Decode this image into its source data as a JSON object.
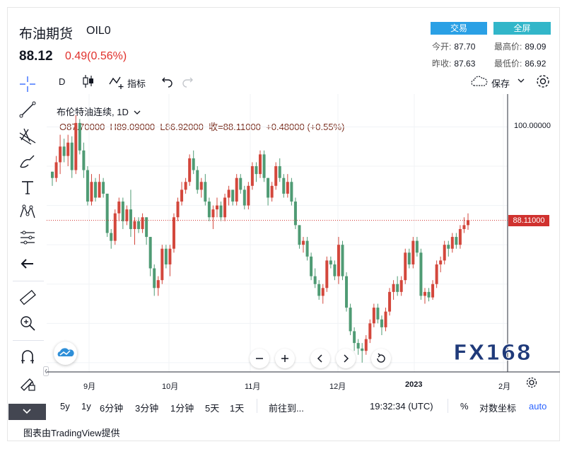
{
  "header": {
    "title": "布油期货",
    "symbol": "OIL0",
    "price": "88.12",
    "change": "0.49(0.56%)",
    "trade_button": "交易",
    "fullscreen_button": "全屏",
    "stats": [
      {
        "label": "今开:",
        "value": "87.70"
      },
      {
        "label": "最高价:",
        "value": "89.09"
      },
      {
        "label": "昨收:",
        "value": "87.63"
      },
      {
        "label": "最低价:",
        "value": "86.92"
      }
    ]
  },
  "toolbar": {
    "interval": "D",
    "indicators_label": "指标",
    "save_label": "保存"
  },
  "legend": {
    "series_name": "布伦特油连续, 1D",
    "ohlc": "O87.70000  H89.09000  L86.92000  收=88.11000  +0.48000 (+0.55%)"
  },
  "bottom_bar": {
    "ranges": [
      "5y",
      "1y",
      "6分钟",
      "3分钟",
      "1分钟",
      "5天",
      "1天"
    ],
    "goto_label": "前往到...",
    "time": "19:32:34 (UTC)",
    "percent": "%",
    "log_label": "对数坐标",
    "auto_label": "auto"
  },
  "footer": {
    "credit": "图表由TradingView提供"
  },
  "watermark": {
    "text": "FX168"
  },
  "colors": {
    "up": "#d3473c",
    "down": "#4f9b74",
    "price_line": "#d0322f",
    "accent": "#2962ff"
  },
  "chart_data": {
    "type": "candlestick",
    "x_ticks": [
      "9月",
      "10月",
      "11月",
      "12月",
      "2023",
      "2月"
    ],
    "y_ticks": [
      "100.00000"
    ],
    "last_price_label": "88.11000",
    "last_price": 88.11,
    "ylim": [
      69,
      104
    ],
    "candles": [
      [
        94.3,
        94.3,
        92.5,
        93.5
      ],
      [
        93.5,
        96.3,
        93.0,
        95.5
      ],
      [
        95.5,
        99.0,
        94.0,
        97.5
      ],
      [
        97.5,
        98.5,
        95.5,
        96.3
      ],
      [
        96.3,
        99.0,
        95.0,
        98.0
      ],
      [
        98.0,
        98.8,
        93.5,
        94.5
      ],
      [
        94.5,
        101.5,
        94.0,
        100.5
      ],
      [
        100.5,
        101.0,
        96.5,
        97.0
      ],
      [
        97.0,
        98.0,
        93.5,
        94.5
      ],
      [
        94.5,
        95.0,
        90.0,
        90.5
      ],
      [
        90.5,
        94.0,
        90.0,
        93.0
      ],
      [
        93.0,
        93.5,
        90.5,
        91.0
      ],
      [
        91.0,
        94.0,
        91.0,
        93.0
      ],
      [
        93.0,
        93.5,
        91.0,
        91.5
      ],
      [
        91.5,
        91.5,
        86.0,
        86.5
      ],
      [
        86.5,
        87.0,
        84.5,
        85.5
      ],
      [
        85.5,
        89.5,
        85.0,
        89.0
      ],
      [
        89.0,
        91.0,
        88.0,
        90.5
      ],
      [
        90.5,
        91.0,
        87.0,
        88.0
      ],
      [
        88.0,
        90.0,
        87.5,
        89.5
      ],
      [
        89.5,
        92.0,
        86.0,
        87.0
      ],
      [
        87.0,
        88.5,
        85.0,
        88.0
      ],
      [
        88.0,
        88.5,
        86.5,
        87.0
      ],
      [
        87.0,
        89.0,
        86.5,
        88.5
      ],
      [
        88.5,
        88.5,
        85.0,
        86.0
      ],
      [
        86.0,
        86.0,
        81.0,
        82.0
      ],
      [
        82.0,
        82.5,
        78.5,
        79.5
      ],
      [
        79.5,
        81.0,
        78.5,
        80.5
      ],
      [
        80.5,
        85.0,
        80.0,
        84.5
      ],
      [
        84.5,
        85.0,
        82.0,
        82.5
      ],
      [
        82.5,
        85.0,
        81.0,
        84.5
      ],
      [
        84.5,
        89.0,
        84.0,
        88.5
      ],
      [
        88.5,
        91.0,
        88.0,
        90.5
      ],
      [
        90.5,
        93.0,
        90.0,
        92.0
      ],
      [
        92.0,
        93.5,
        91.5,
        93.0
      ],
      [
        93.0,
        96.5,
        92.5,
        96.0
      ],
      [
        96.0,
        97.0,
        94.0,
        94.5
      ],
      [
        94.5,
        95.0,
        91.5,
        92.0
      ],
      [
        92.0,
        93.5,
        91.0,
        93.0
      ],
      [
        93.0,
        94.0,
        90.0,
        90.5
      ],
      [
        90.5,
        91.0,
        88.0,
        88.5
      ],
      [
        88.5,
        90.0,
        87.0,
        89.5
      ],
      [
        89.5,
        91.0,
        88.5,
        90.0
      ],
      [
        90.0,
        90.5,
        88.0,
        88.5
      ],
      [
        88.5,
        91.5,
        88.0,
        91.0
      ],
      [
        91.0,
        92.5,
        90.0,
        92.0
      ],
      [
        92.0,
        92.0,
        90.0,
        90.5
      ],
      [
        90.5,
        94.0,
        90.0,
        93.5
      ],
      [
        93.5,
        94.0,
        91.5,
        92.0
      ],
      [
        92.0,
        92.5,
        89.5,
        90.0
      ],
      [
        90.0,
        93.0,
        89.5,
        92.5
      ],
      [
        92.5,
        95.5,
        92.0,
        95.0
      ],
      [
        95.0,
        95.5,
        93.0,
        94.0
      ],
      [
        94.0,
        97.0,
        93.5,
        96.5
      ],
      [
        96.5,
        97.0,
        93.0,
        93.5
      ],
      [
        93.5,
        93.5,
        90.0,
        91.0
      ],
      [
        91.0,
        93.0,
        90.5,
        92.5
      ],
      [
        92.5,
        95.5,
        92.0,
        95.0
      ],
      [
        95.0,
        96.0,
        93.0,
        93.5
      ],
      [
        93.5,
        94.0,
        91.0,
        91.5
      ],
      [
        91.5,
        94.0,
        91.0,
        93.0
      ],
      [
        93.0,
        93.5,
        90.0,
        90.5
      ],
      [
        90.5,
        91.0,
        87.0,
        87.5
      ],
      [
        87.5,
        87.5,
        84.5,
        85.0
      ],
      [
        85.0,
        86.0,
        84.0,
        85.5
      ],
      [
        85.5,
        86.0,
        83.0,
        83.5
      ],
      [
        83.5,
        84.0,
        80.5,
        81.0
      ],
      [
        81.0,
        82.0,
        79.5,
        80.0
      ],
      [
        80.0,
        80.5,
        78.0,
        78.5
      ],
      [
        78.5,
        80.0,
        77.5,
        79.5
      ],
      [
        79.5,
        83.5,
        79.0,
        83.0
      ],
      [
        83.0,
        83.5,
        82.0,
        82.5
      ],
      [
        82.5,
        83.0,
        80.5,
        81.0
      ],
      [
        81.0,
        86.0,
        80.0,
        85.0
      ],
      [
        85.0,
        85.5,
        80.5,
        81.0
      ],
      [
        81.0,
        81.5,
        76.5,
        77.0
      ],
      [
        77.0,
        77.5,
        73.5,
        74.0
      ],
      [
        74.0,
        74.5,
        71.5,
        72.5
      ],
      [
        72.5,
        73.0,
        71.0,
        71.8
      ],
      [
        71.8,
        72.5,
        70.0,
        71.5
      ],
      [
        71.5,
        73.5,
        71.0,
        73.0
      ],
      [
        73.0,
        75.5,
        72.5,
        75.0
      ],
      [
        75.0,
        77.5,
        74.5,
        77.0
      ],
      [
        77.0,
        77.5,
        75.0,
        75.5
      ],
      [
        75.5,
        76.0,
        73.5,
        74.5
      ],
      [
        74.5,
        77.0,
        74.0,
        76.5
      ],
      [
        76.5,
        79.5,
        76.0,
        79.0
      ],
      [
        79.0,
        80.5,
        78.0,
        80.0
      ],
      [
        80.0,
        81.0,
        78.5,
        79.0
      ],
      [
        79.0,
        81.0,
        78.5,
        80.5
      ],
      [
        80.5,
        84.5,
        80.0,
        84.0
      ],
      [
        84.0,
        84.5,
        82.0,
        82.5
      ],
      [
        82.5,
        86.0,
        82.0,
        85.5
      ],
      [
        85.5,
        86.0,
        83.5,
        84.0
      ],
      [
        84.0,
        84.5,
        78.0,
        78.5
      ],
      [
        78.5,
        79.5,
        77.5,
        79.0
      ],
      [
        79.0,
        79.5,
        77.8,
        78.3
      ],
      [
        78.3,
        80.5,
        78.0,
        80.0
      ],
      [
        80.0,
        83.0,
        79.5,
        82.5
      ],
      [
        82.5,
        83.5,
        81.5,
        83.0
      ],
      [
        83.0,
        85.5,
        82.5,
        85.0
      ],
      [
        85.0,
        85.5,
        83.5,
        84.5
      ],
      [
        84.5,
        86.5,
        84.0,
        86.0
      ],
      [
        86.0,
        86.5,
        84.5,
        85.0
      ],
      [
        85.0,
        87.5,
        84.5,
        87.0
      ],
      [
        87.0,
        88.5,
        86.5,
        87.5
      ],
      [
        87.5,
        89.0,
        86.9,
        88.11
      ]
    ]
  }
}
